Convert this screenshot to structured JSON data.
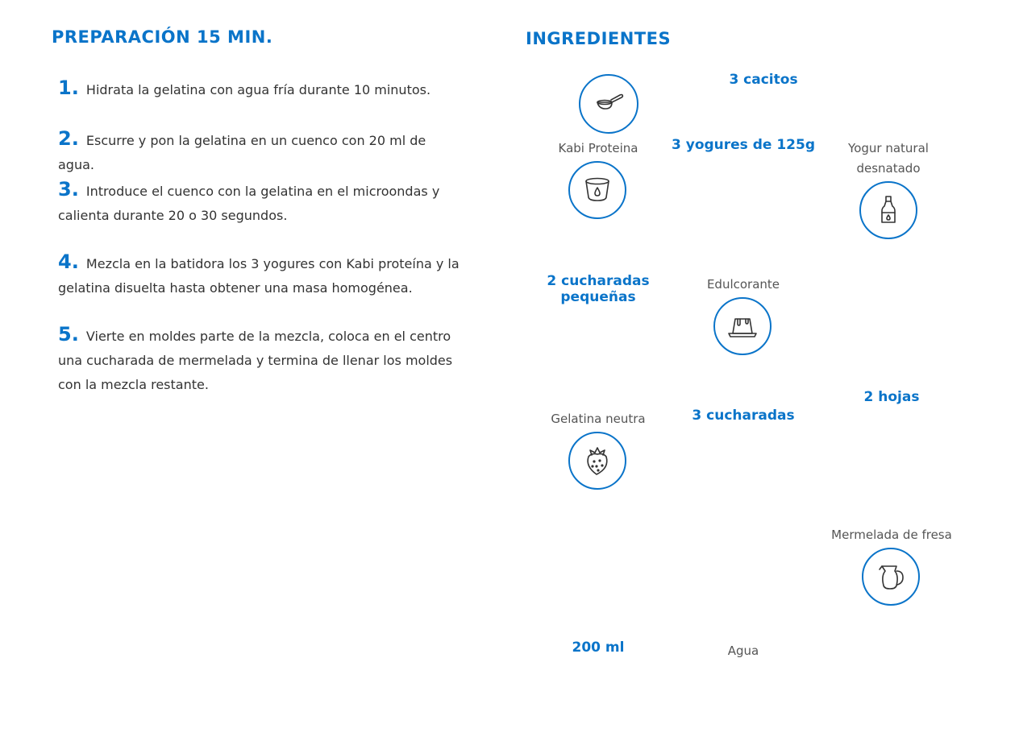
{
  "preparation": {
    "title": "PREPARACIÓN 15 MIN.",
    "steps": [
      {
        "num": "1.",
        "text": "Hidrata la gelatina con agua fría durante 10 minutos."
      },
      {
        "num": "2.",
        "text": "Escurre y pon la gelatina en un cuenco con 20 ml de agua."
      },
      {
        "num": "3.",
        "text": "Introduce el cuenco con la gelatina en el microondas y calienta durante 20 o 30 segundos."
      },
      {
        "num": "4.",
        "text": "Mezcla en la batidora los 3 yogures con Kabi proteína y la gelatina disuelta hasta obtener una masa homogénea."
      },
      {
        "num": "5.",
        "text": "Vierte en moldes parte de la mezcla, coloca en el centro una cucharada de mermelada y termina de llenar los moldes con la mezcla restante."
      }
    ]
  },
  "ingredients": {
    "title": "INGREDIENTES",
    "items": [
      {
        "qty": "3 cacitos",
        "name": "Kabi Proteina",
        "icon": "scoop-icon"
      },
      {
        "qty": "3 yogures de 125g",
        "name": "Yogur natural desnatado",
        "icon": "yogurt-cup-icon"
      },
      {
        "qty": "2 cucharadas pequeñas",
        "name": "Edulcorante",
        "icon": "sweetener-bottle-icon"
      },
      {
        "qty": "2 hojas",
        "name": "Gelatina neutra",
        "icon": "gelatin-icon"
      },
      {
        "qty": "3 cucharadas",
        "name": "Mermelada de fresa",
        "icon": "strawberry-icon"
      },
      {
        "qty": "200 ml",
        "name": "Agua",
        "icon": "water-jug-icon"
      }
    ]
  },
  "colors": {
    "accent": "#0a74c9",
    "text": "#333333",
    "label": "#555555"
  }
}
